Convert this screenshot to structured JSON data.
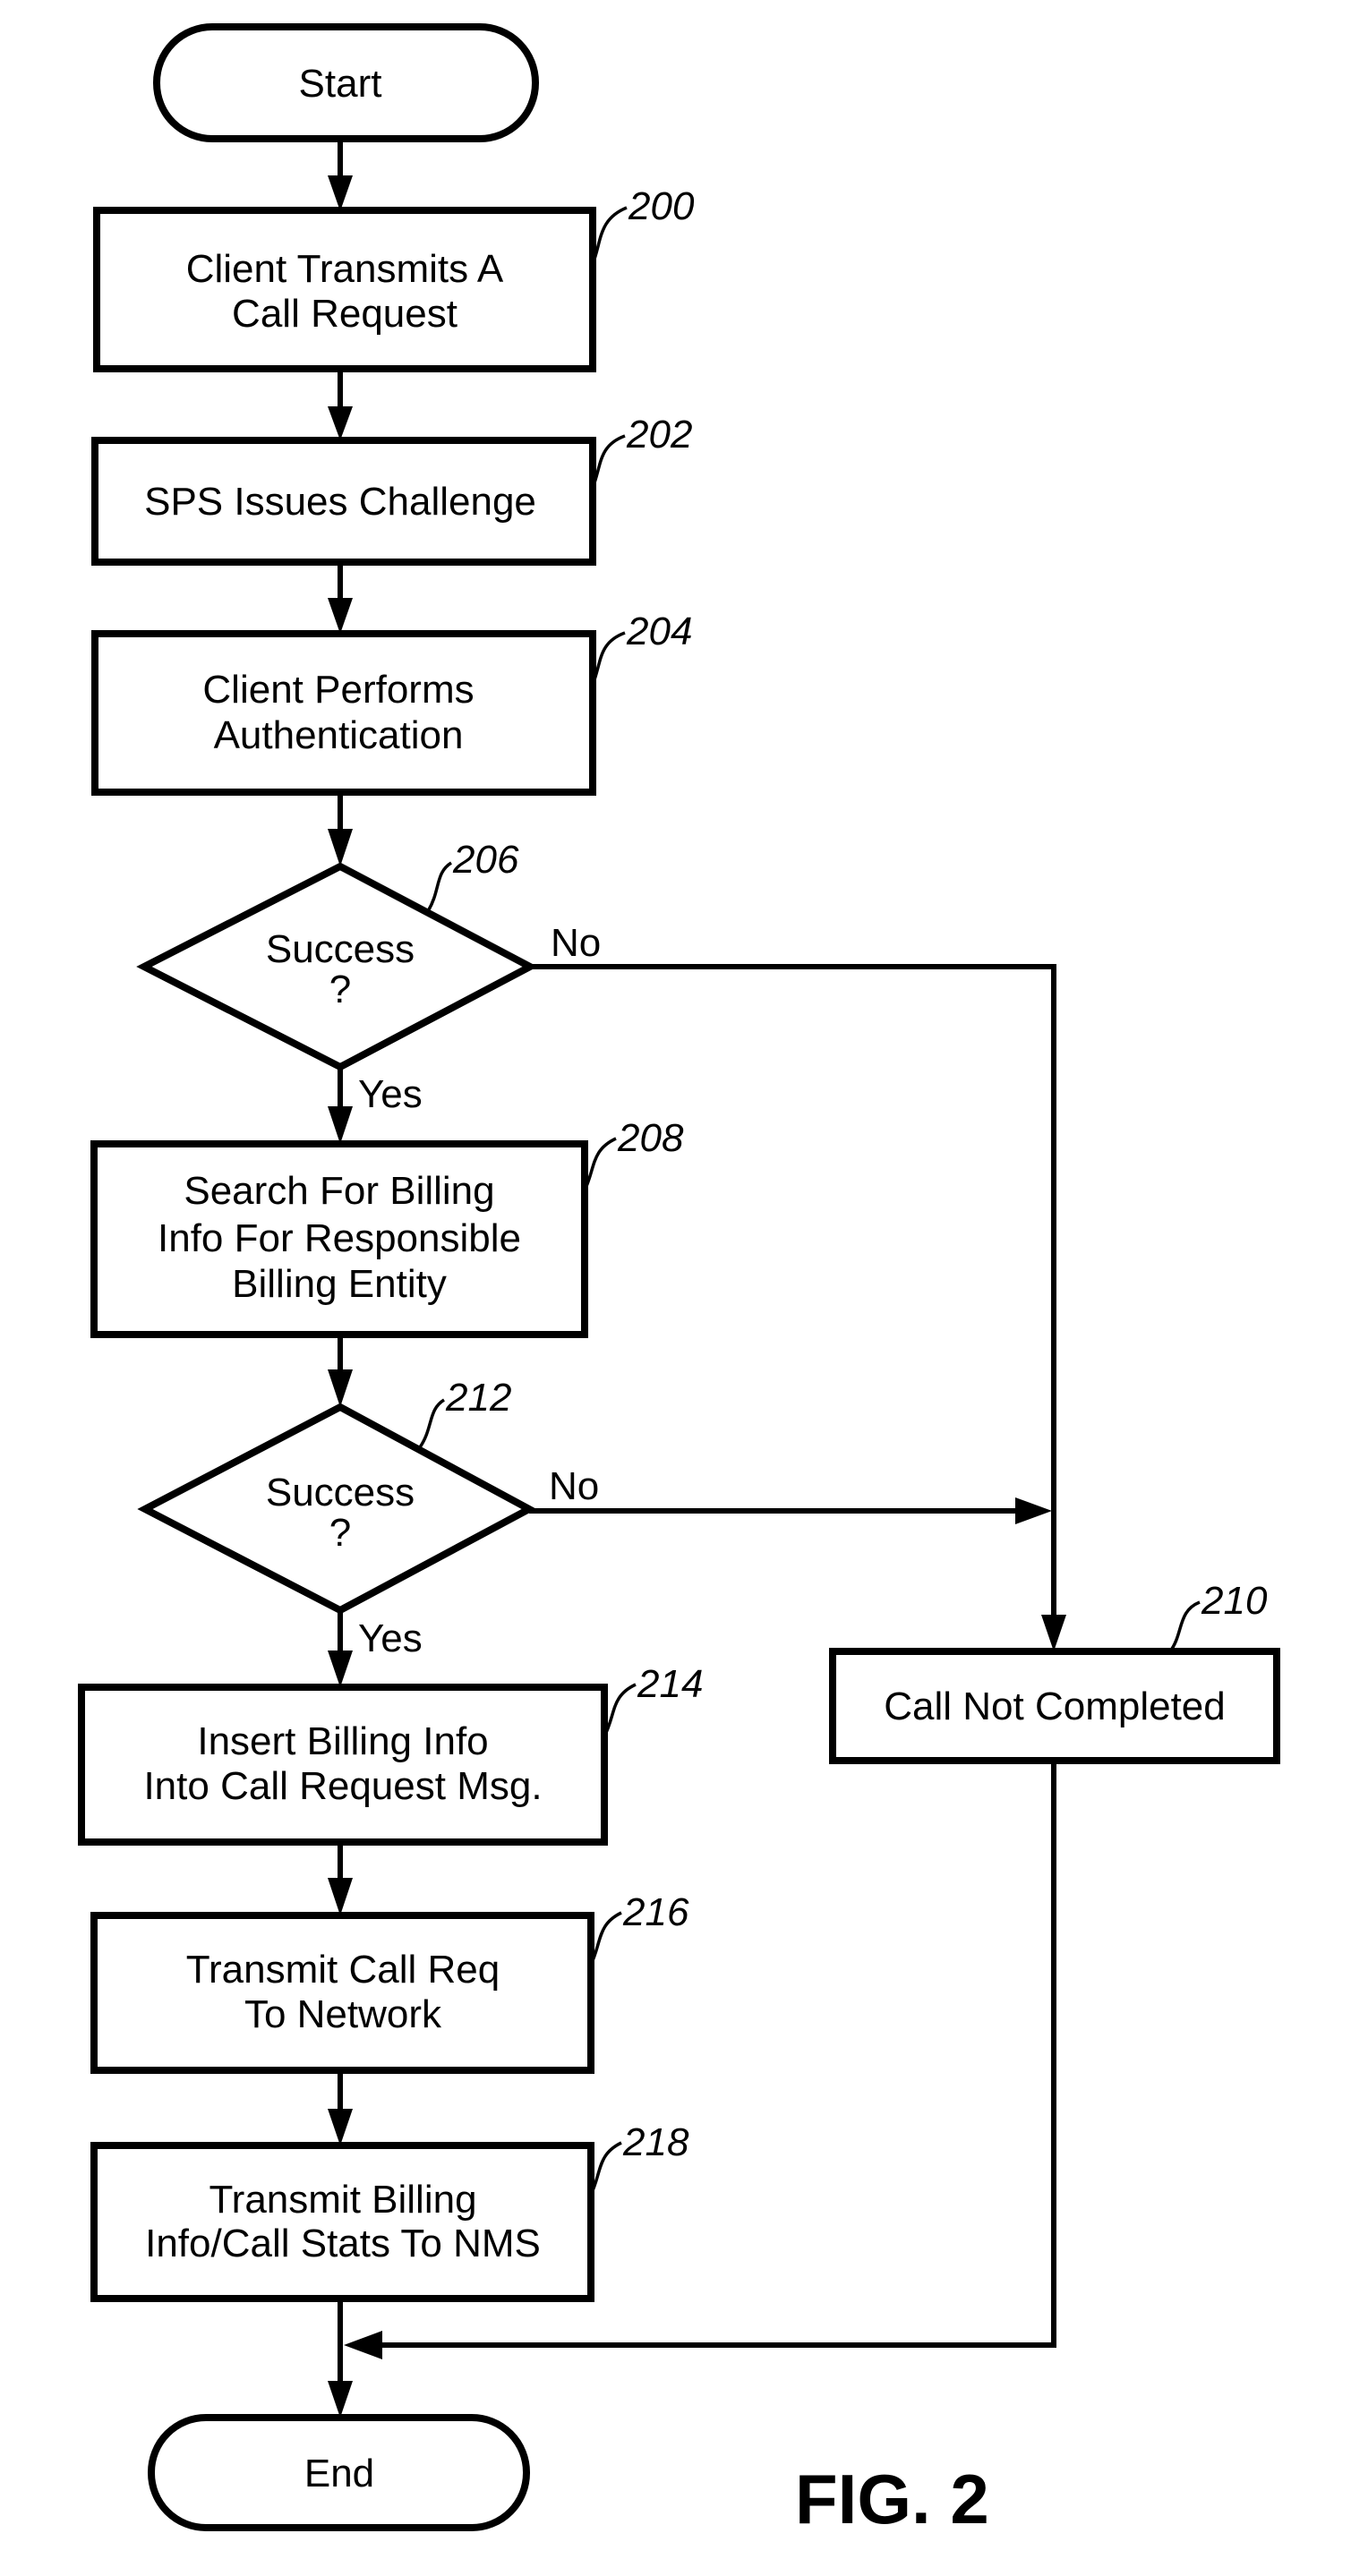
{
  "figure": {
    "caption": "FIG. 2",
    "nodes": [
      {
        "id": "start",
        "type": "terminal",
        "lines": [
          "Start"
        ]
      },
      {
        "id": "200",
        "type": "process",
        "ref": "200",
        "lines": [
          "Client Transmits A",
          "Call Request"
        ]
      },
      {
        "id": "202",
        "type": "process",
        "ref": "202",
        "lines": [
          "SPS Issues Challenge"
        ]
      },
      {
        "id": "204",
        "type": "process",
        "ref": "204",
        "lines": [
          "Client Performs",
          "Authentication"
        ]
      },
      {
        "id": "206",
        "type": "decision",
        "ref": "206",
        "lines": [
          "Success",
          "?"
        ]
      },
      {
        "id": "208",
        "type": "process",
        "ref": "208",
        "lines": [
          "Search For Billing",
          "Info For Responsible",
          "Billing Entity"
        ]
      },
      {
        "id": "212",
        "type": "decision",
        "ref": "212",
        "lines": [
          "Success",
          "?"
        ]
      },
      {
        "id": "214",
        "type": "process",
        "ref": "214",
        "lines": [
          "Insert Billing Info",
          "Into Call Request Msg."
        ]
      },
      {
        "id": "216",
        "type": "process",
        "ref": "216",
        "lines": [
          "Transmit Call Req",
          "To Network"
        ]
      },
      {
        "id": "218",
        "type": "process",
        "ref": "218",
        "lines": [
          "Transmit Billing",
          "Info/Call Stats To NMS"
        ]
      },
      {
        "id": "210",
        "type": "process",
        "ref": "210",
        "lines": [
          "Call Not Completed"
        ]
      },
      {
        "id": "end",
        "type": "terminal",
        "lines": [
          "End"
        ]
      }
    ],
    "edges": [
      {
        "from": "start",
        "to": "200",
        "label": ""
      },
      {
        "from": "200",
        "to": "202",
        "label": ""
      },
      {
        "from": "202",
        "to": "204",
        "label": ""
      },
      {
        "from": "204",
        "to": "206",
        "label": ""
      },
      {
        "from": "206",
        "to": "208",
        "label": "Yes"
      },
      {
        "from": "206",
        "to": "210",
        "label": "No"
      },
      {
        "from": "208",
        "to": "212",
        "label": ""
      },
      {
        "from": "212",
        "to": "214",
        "label": "Yes"
      },
      {
        "from": "212",
        "to": "210",
        "label": "No"
      },
      {
        "from": "214",
        "to": "216",
        "label": ""
      },
      {
        "from": "216",
        "to": "218",
        "label": ""
      },
      {
        "from": "218",
        "to": "end",
        "label": ""
      },
      {
        "from": "210",
        "to": "end",
        "label": ""
      }
    ],
    "branch_labels": {
      "yes": "Yes",
      "no": "No"
    }
  }
}
